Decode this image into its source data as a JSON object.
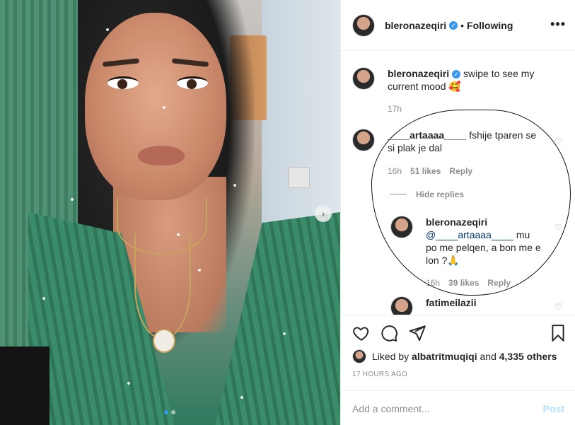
{
  "post": {
    "author": "bleronazeqiri",
    "follow_status": "Following",
    "separator": "•",
    "more_label": "•••",
    "caption_text": "swipe to see my current mood 🥰",
    "caption_time": "17h",
    "carousel": {
      "current_slide": 1,
      "total_slides": 2
    }
  },
  "comments": [
    {
      "user": "____artaaaa____",
      "text": "fshije tparen se si plak je dal",
      "time": "16h",
      "likes": "51 likes",
      "reply_label": "Reply"
    }
  ],
  "hide_replies_label": "Hide replies",
  "replies": [
    {
      "user": "bleronazeqiri",
      "mention": "@____artaaaa____",
      "text": "mu po me pelqen, a bon me e lon ?🙏",
      "time": "16h",
      "likes": "39 likes",
      "reply_label": "Reply"
    },
    {
      "user": "fatimeilazii"
    }
  ],
  "actions": {
    "liked_by_prefix": "Liked by",
    "liked_by_user": "albatritmuqiqi",
    "and": "and",
    "others": "4,335 others",
    "time_ago": "17 HOURS AGO"
  },
  "comment_box": {
    "placeholder": "Add a comment...",
    "post_label": "Post"
  },
  "colors": {
    "accent": "#3897f0",
    "muted": "#8e8e8e",
    "text": "#262626"
  }
}
